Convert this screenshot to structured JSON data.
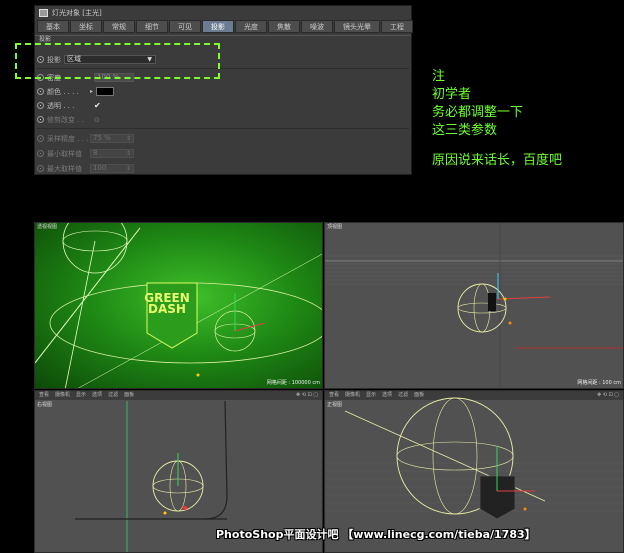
{
  "panel": {
    "title": "灯光对象 [主光]",
    "tabs": [
      "基本",
      "坐标",
      "常规",
      "细节",
      "可见",
      "投影",
      "光度",
      "焦散",
      "噪波",
      "镜头光晕",
      "工程"
    ],
    "active_tab": "投影",
    "section_title": "投影",
    "shadow_label": "投影",
    "shadow_value": "区域",
    "density_label": "密度",
    "density_value": "100 %",
    "color_label": "颜色 . . . .",
    "transparency_label": "透明 . . .",
    "transparency_check": "✔",
    "clip_label": "修剪改变 . .",
    "sampling_label": "采样精度 . . .",
    "sampling_value": "75 %",
    "min_samples_label": "最小取样值",
    "min_samples_value": "8",
    "max_samples_label": "最大取样值",
    "max_samples_value": "100",
    "swatch_color": "#000000"
  },
  "note": {
    "lines": [
      "注",
      "初学者",
      "务必都调整一下",
      "这三类参数",
      "",
      "原因说来话长，百度吧"
    ],
    "color": "#6dff2e"
  },
  "viewports": {
    "perspective": {
      "label": "透视视图",
      "scale": "网格间距 : 100000 cm",
      "logo_line1": "GREEN",
      "logo_line2": "DASH"
    },
    "top": {
      "label": "顶视图",
      "scale": "网格间距 : 100 cm"
    },
    "right": {
      "label": "右视图"
    },
    "front": {
      "label": "正视图"
    },
    "toolbar": [
      "查看",
      "摄像机",
      "显示",
      "选项",
      "过滤",
      "面板"
    ],
    "nav_icons": "✥ ⟲ ⊡ ▢"
  },
  "watermark": "PhotoShop平面设计吧 【www.linecg.com/tieba/1783】"
}
